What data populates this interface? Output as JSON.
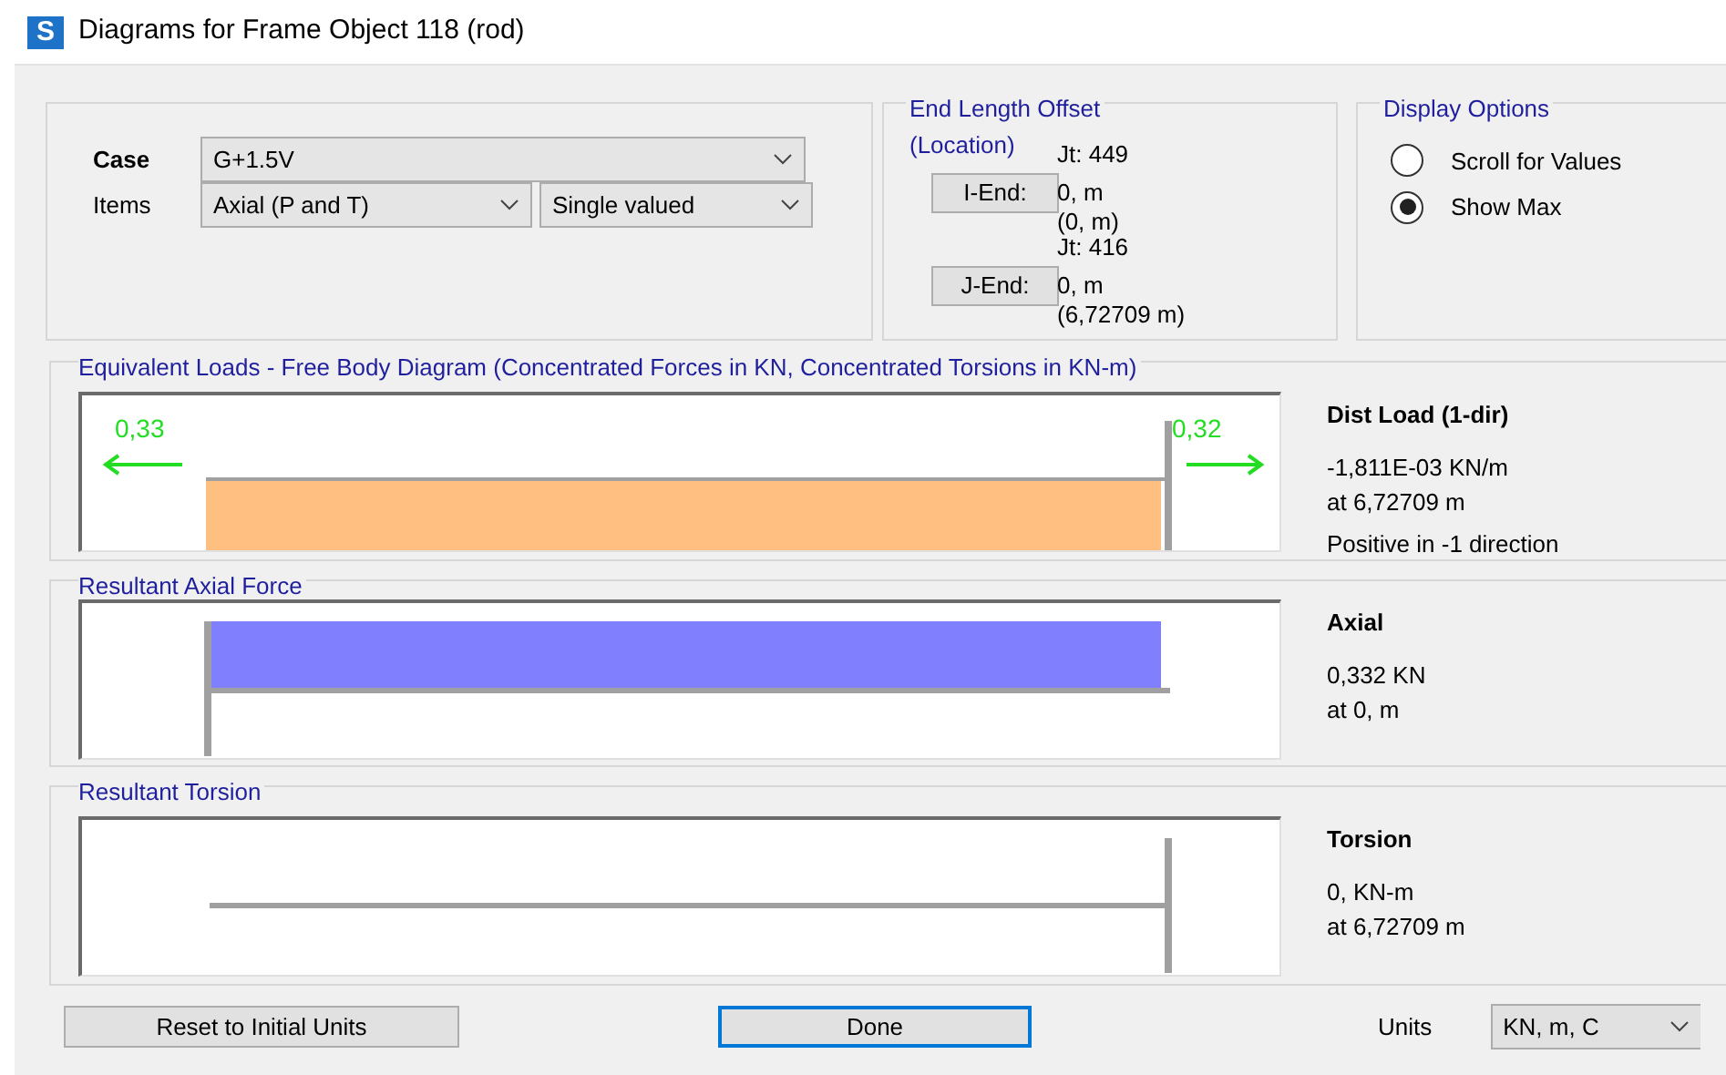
{
  "window": {
    "app_icon": "S",
    "title": "Diagrams for Frame Object 118  (rod)"
  },
  "case": {
    "label": "Case",
    "value": "G+1.5V"
  },
  "items": {
    "label": "Items",
    "value": "Axial (P and T)",
    "mode": "Single valued"
  },
  "end_length_offset": {
    "title": "End Length Offset",
    "subtitle": "(Location)",
    "ends": [
      {
        "button": "I-End:",
        "joint": "Jt:  449",
        "offset": "0, m",
        "location": "(0, m)"
      },
      {
        "button": "J-End:",
        "joint": "Jt:  416",
        "offset": "0, m",
        "location": "(6,72709 m)"
      }
    ]
  },
  "display_options": {
    "title": "Display Options",
    "options": [
      {
        "label": "Scroll for Values",
        "selected": false
      },
      {
        "label": "Show Max",
        "selected": true
      }
    ]
  },
  "panels": [
    {
      "kind": "load",
      "title": "Equivalent Loads - Free Body Diagram  (Concentrated Forces in KN, Concentrated Torsions in KN-m)",
      "left_value": "0,33",
      "right_value": "0,32",
      "heading": "Dist Load (1-dir)",
      "lines": [
        "-1,811E-03 KN/m",
        "at 6,72709 m",
        "Positive in -1 direction"
      ]
    },
    {
      "kind": "axial",
      "title": "Resultant Axial Force",
      "heading": "Axial",
      "lines": [
        "0,332 KN",
        "at 0, m"
      ]
    },
    {
      "kind": "torsion",
      "title": "Resultant Torsion",
      "heading": "Torsion",
      "lines": [
        "0, KN-m",
        "at 6,72709 m"
      ]
    }
  ],
  "footer": {
    "reset": "Reset to Initial Units",
    "done": "Done",
    "units_label": "Units",
    "units": "KN, m, C"
  }
}
